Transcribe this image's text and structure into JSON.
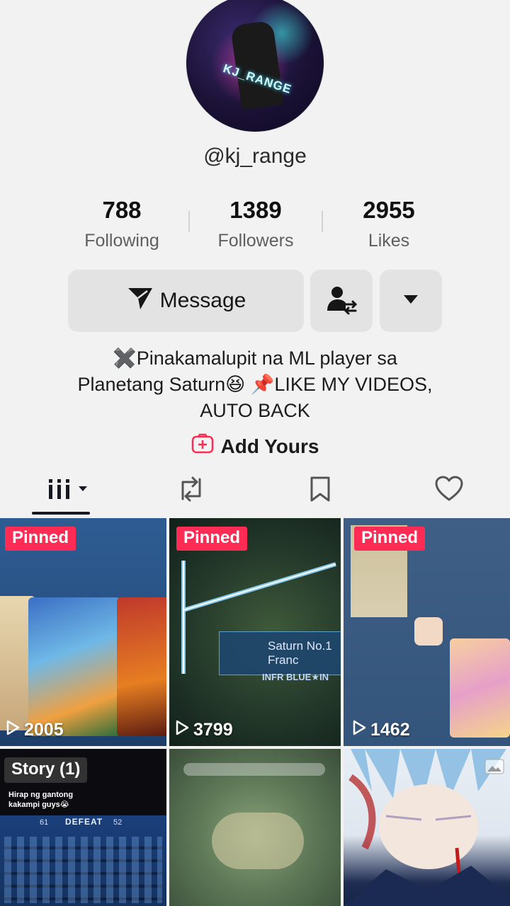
{
  "profile": {
    "handle": "@kj_range",
    "avatar_text": "KJ_RANGE"
  },
  "stats": [
    {
      "value": "788",
      "label": "Following"
    },
    {
      "value": "1389",
      "label": "Followers"
    },
    {
      "value": "2955",
      "label": "Likes"
    }
  ],
  "actions": {
    "message_label": "Message",
    "message_icon": "send-arrow-icon",
    "follow_icon": "user-switch-icon",
    "more_icon": "caret-down-icon"
  },
  "bio": {
    "line1": "✖️Pinakamalupit na ML player sa",
    "line2": "Planetang Saturn😆 📌LIKE MY VIDEOS,",
    "line3": "AUTO BACK"
  },
  "add_yours": {
    "label": "Add Yours",
    "icon": "plus-box-icon",
    "color": "#fe2c55"
  },
  "tabs": [
    {
      "name": "videos",
      "icon": "grid-icon"
    },
    {
      "name": "reposts",
      "icon": "repost-icon"
    },
    {
      "name": "favorites",
      "icon": "bookmark-icon"
    },
    {
      "name": "liked",
      "icon": "heart-icon"
    }
  ],
  "videos": [
    {
      "badge": "Pinned",
      "views": "2005"
    },
    {
      "badge": "Pinned",
      "views": "3799",
      "overlay_title": "Saturn No.1 Franc",
      "overlay_sub": "INFR BLUE★IN"
    },
    {
      "badge": "Pinned",
      "views": "1462"
    },
    {
      "badge": "Story (1)",
      "caption": "Hirap ng gantong kakampi guys😭",
      "score_left": "61",
      "score_label": "DEFEAT",
      "score_right": "52"
    },
    {},
    {}
  ],
  "colors": {
    "accent": "#fe2c55",
    "background": "#f2f2f2",
    "button": "#e3e3e3"
  }
}
